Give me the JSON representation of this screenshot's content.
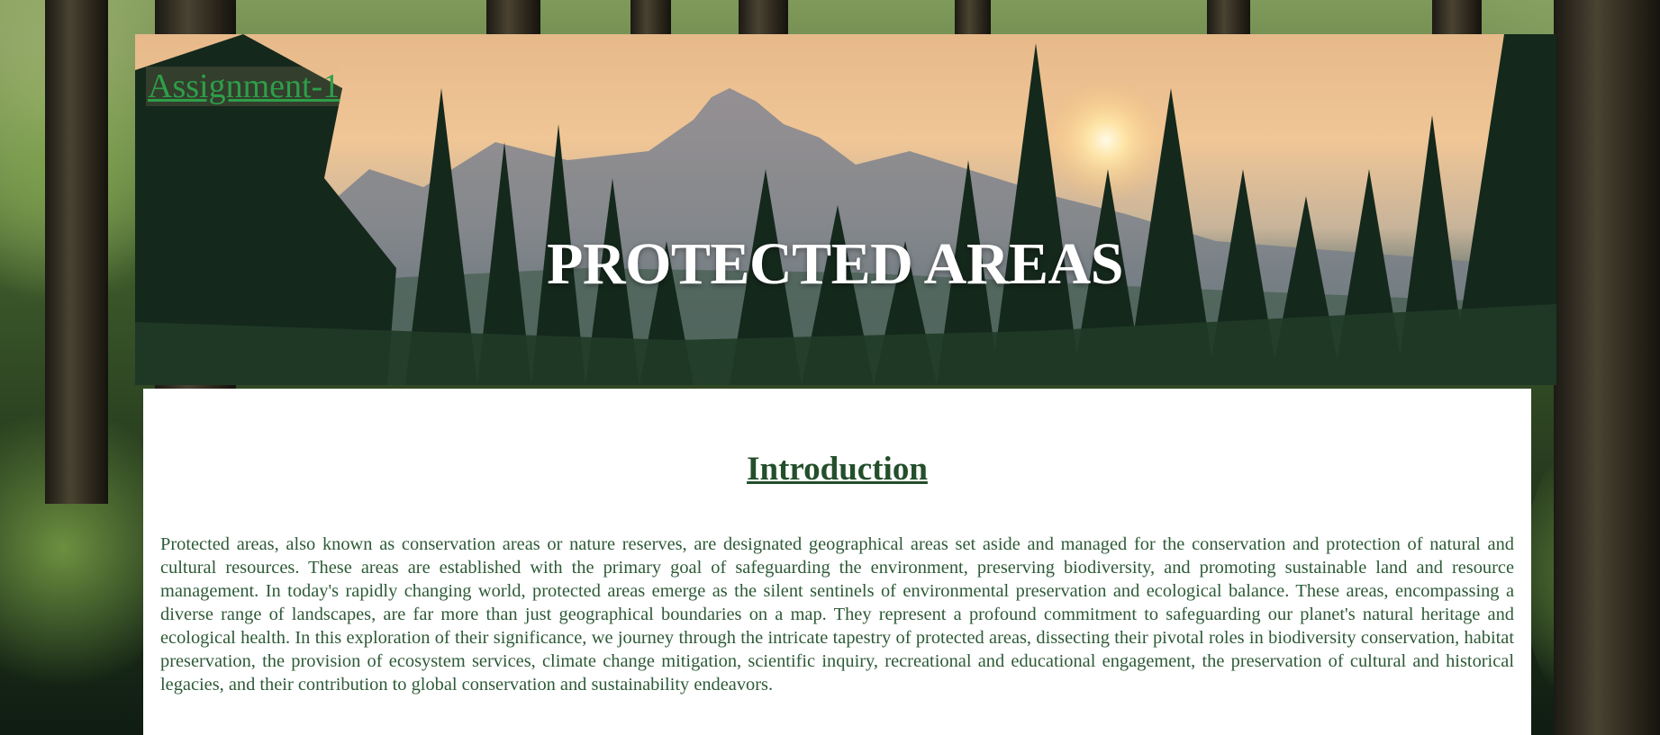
{
  "header": {
    "assignment_link": "Assignment-1",
    "title": "PROTECTED AREAS"
  },
  "intro": {
    "heading": "Introduction",
    "paragraph": "Protected areas, also known as conservation areas or nature reserves, are designated geographical areas set aside and managed for the conservation and protection of natural and cultural resources. These areas are established with the primary goal of safeguarding the environment, preserving biodiversity, and promoting sustainable land and resource management. In today's rapidly changing world, protected areas emerge as the silent sentinels of environmental preservation and ecological balance. These areas, encompassing a diverse range of landscapes, are far more than just geographical boundaries on a map. They represent a profound commitment to safeguarding our planet's natural heritage and ecological health. In this exploration of their significance, we journey through the intricate tapestry of protected areas, dissecting their pivotal roles in biodiversity conservation, habitat preservation, the provision of ecosystem services, climate change mitigation, scientific inquiry, recreational and educational engagement, the preservation of cultural and historical legacies, and their contribution to global conservation and sustainability endeavors."
  },
  "colors": {
    "link": "#2e9e49",
    "heading": "#234f2b",
    "body_text": "#2d5a36",
    "panel": "#ffffff"
  }
}
